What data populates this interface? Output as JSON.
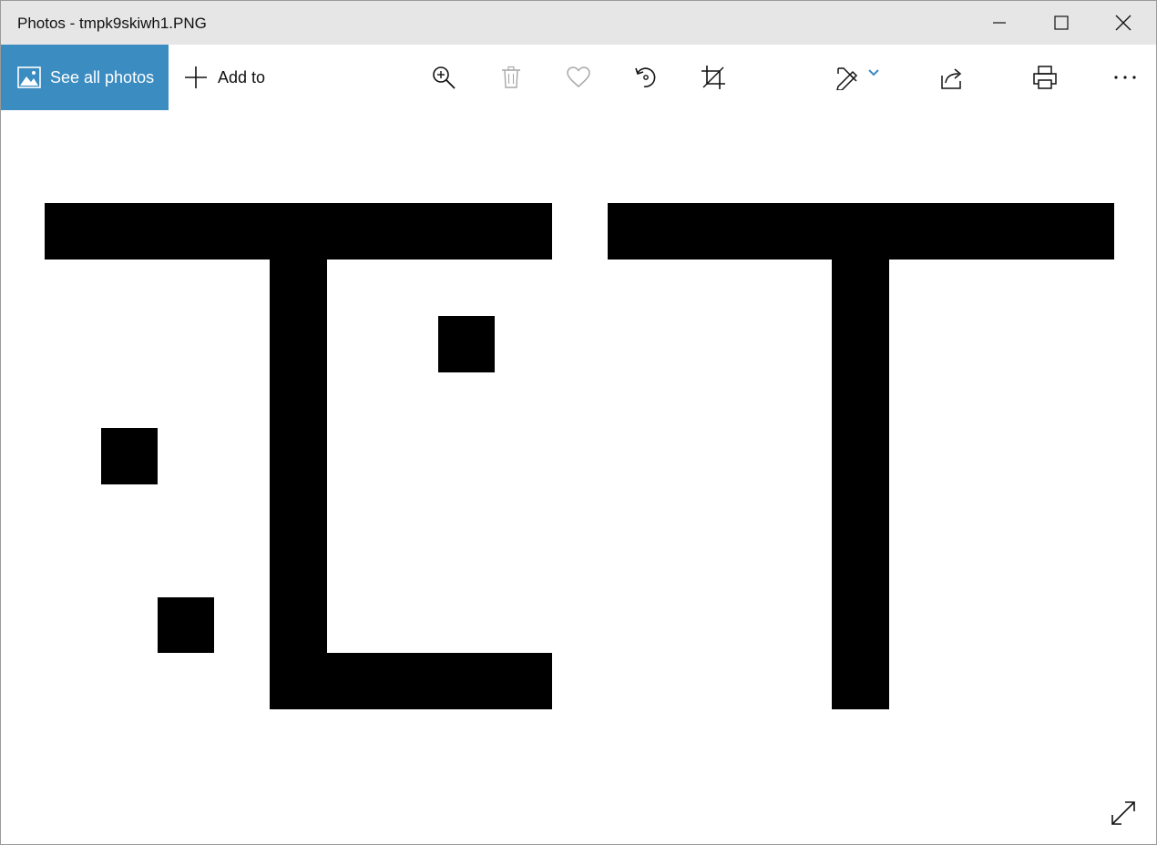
{
  "window": {
    "title": "Photos - tmpk9skiwh1.PNG"
  },
  "toolbar": {
    "see_all_label": "See all photos",
    "add_to_label": "Add to",
    "accent_color": "#3b8cc1"
  },
  "icons": {
    "photos": "photos-icon",
    "add": "plus-icon",
    "zoom": "zoom-in-icon",
    "delete": "trash-icon",
    "favorite": "heart-icon",
    "rotate": "rotate-icon",
    "crop": "crop-icon",
    "edit": "edit-create-icon",
    "share": "share-icon",
    "print": "print-icon",
    "more": "more-icon",
    "expand": "expand-icon"
  },
  "image": {
    "content": "black shapes on white background",
    "colors": {
      "shape": "#000000",
      "background": "#ffffff"
    }
  }
}
